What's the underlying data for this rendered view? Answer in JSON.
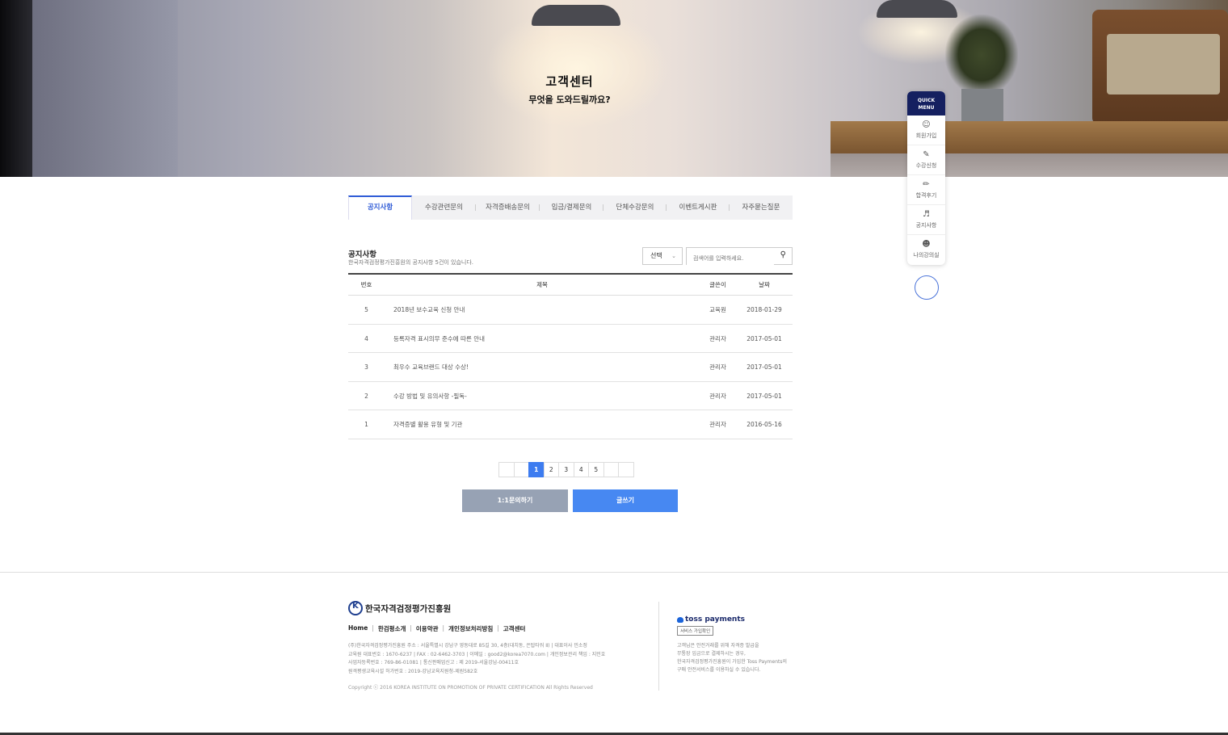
{
  "hero": {
    "title": "고객센터",
    "subtitle": "무엇을 도와드릴까요?"
  },
  "quick_menu": {
    "header": [
      "QUICK",
      "MENU"
    ],
    "items": [
      {
        "label": "회원가입",
        "icon": "user-add-icon"
      },
      {
        "label": "수강신청",
        "icon": "edit-doc-icon"
      },
      {
        "label": "합격후기",
        "icon": "pencil-icon"
      },
      {
        "label": "공지사항",
        "icon": "megaphone-icon"
      },
      {
        "label": "나의강의실",
        "icon": "user-icon"
      }
    ]
  },
  "tabs": [
    {
      "label": "공지사항",
      "active": true
    },
    {
      "label": "수강관련문의",
      "active": false
    },
    {
      "label": "자격증배송문의",
      "active": false
    },
    {
      "label": "입금/결제문의",
      "active": false
    },
    {
      "label": "단체수강문의",
      "active": false
    },
    {
      "label": "이벤트게시판",
      "active": false
    },
    {
      "label": "자주묻는질문",
      "active": false
    }
  ],
  "board": {
    "title": "공지사항",
    "description": "한국자격검정평가진흥원의 공지사항 5건이 있습니다.",
    "select_value": "선택",
    "search_placeholder": "검색어를 입력하세요.",
    "columns": {
      "no": "번호",
      "title": "제목",
      "author": "글쓴이",
      "date": "날짜"
    },
    "rows": [
      {
        "no": "5",
        "title": "2018년 보수교육 신청 안내",
        "author": "교육원",
        "date": "2018-01-29"
      },
      {
        "no": "4",
        "title": "등록자격 표시의무 준수에 따른 안내",
        "author": "관리자",
        "date": "2017-05-01"
      },
      {
        "no": "3",
        "title": "최우수 교육브랜드 대상 수상!",
        "author": "관리자",
        "date": "2017-05-01"
      },
      {
        "no": "2",
        "title": "수강 방법 및 유의사항 -필독-",
        "author": "관리자",
        "date": "2017-05-01"
      },
      {
        "no": "1",
        "title": "자격증별 활용 유형 및 기관",
        "author": "관리자",
        "date": "2016-05-16"
      }
    ]
  },
  "pagination": {
    "pages": [
      "1",
      "2",
      "3",
      "4",
      "5"
    ],
    "current": "1"
  },
  "buttons": {
    "inquiry": "1:1문의하기",
    "write": "글쓰기"
  },
  "footer": {
    "org_name": "한국자격검정평가진흥원",
    "links": [
      "Home",
      "한검평소개",
      "이용약관",
      "개인정보처리방침",
      "고객센터"
    ],
    "info_lines": [
      "(주)한국자격검정평가진흥원 주소 : 서울특별시 강남구 영동대로 85길 30, 4층(대치동, 은탑타워 Ⅱ) | 대표이사 민소정",
      "교육원 대표번호 : 1670-6237 | FAX : 02-6462-3703 | 이메일 : good2@korea7070.com | 개인정보관리 책임 : 지민호",
      "사업자등록번호 : 769-86-01081 | 통신판매업신고 : 제 2019-서울강남-00411호",
      "원격평생교육시설 허가번호 : 2019-강남교육지원청-제원582호"
    ],
    "copyright": "Copyright ⓒ 2016 KOREA INSTITUTE ON PROMOTION OF PRIVATE CERTIFICATION All Rights Reserved",
    "toss_name": "toss payments",
    "toss_badge": "서비스 가입확인",
    "toss_desc": [
      "고객님은 안전거래를 위해 자격증 발급을",
      "무통장 입금으로 결제하시는 경우,",
      "한국자격검정평가진흥원이 가입한 Toss Payments의",
      "구매 안전서비스를 이용하실 수 있습니다."
    ]
  },
  "colors": {
    "accent": "#2f5bd6",
    "quick_header": "#152060",
    "write_button": "#4788f2",
    "inquiry_button": "#97a2b4",
    "page_active": "#3d7cf0"
  }
}
